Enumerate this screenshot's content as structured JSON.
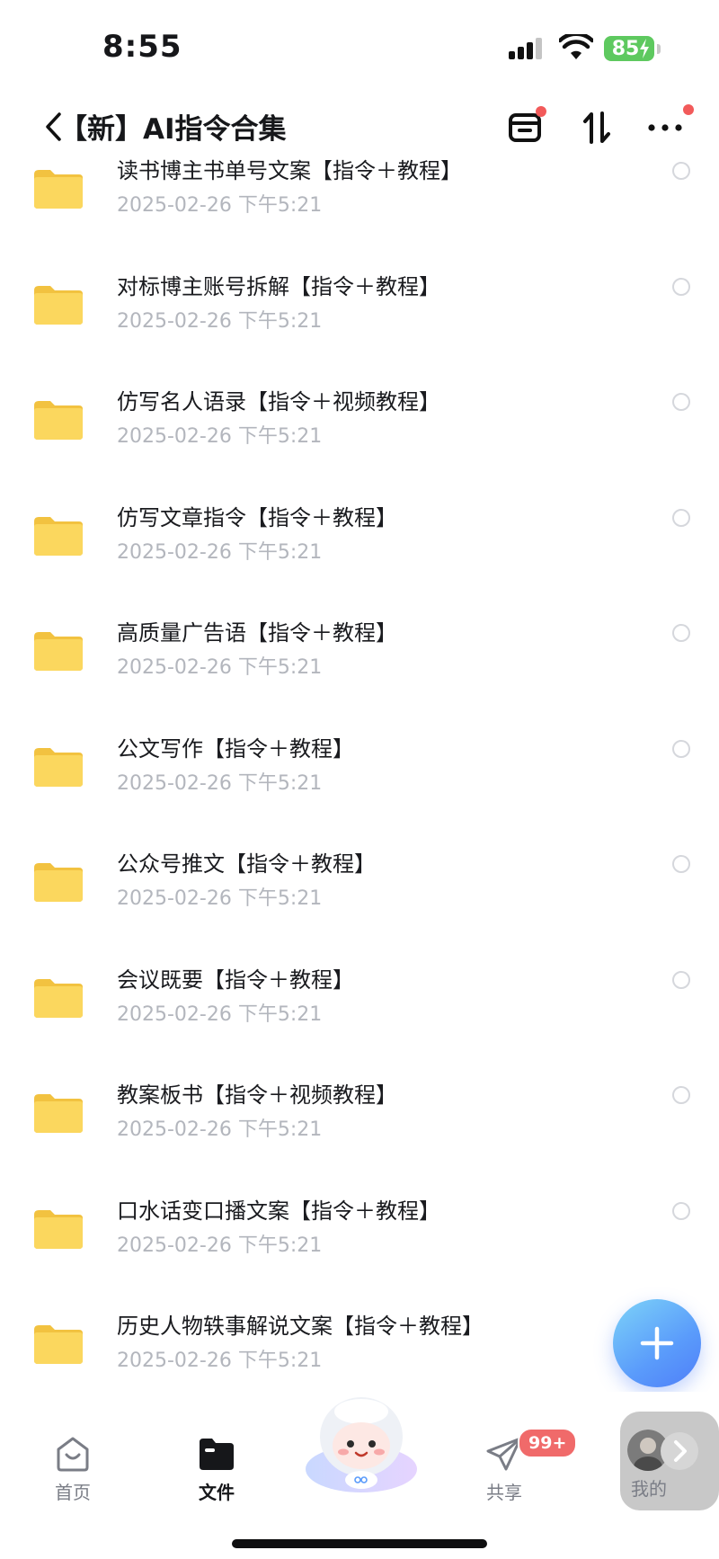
{
  "status": {
    "time": "8:55",
    "battery": "85"
  },
  "nav": {
    "back_title": "【新】AI指令合集"
  },
  "files": [
    {
      "title": "读书博主书单号文案【指令＋教程】",
      "date": "2025-02-26 下午5:21"
    },
    {
      "title": "对标博主账号拆解【指令＋教程】",
      "date": "2025-02-26 下午5:21"
    },
    {
      "title": "仿写名人语录【指令＋视频教程】",
      "date": "2025-02-26 下午5:21"
    },
    {
      "title": "仿写文章指令【指令＋教程】",
      "date": "2025-02-26 下午5:21"
    },
    {
      "title": "高质量广告语【指令＋教程】",
      "date": "2025-02-26 下午5:21"
    },
    {
      "title": "公文写作【指令＋教程】",
      "date": "2025-02-26 下午5:21"
    },
    {
      "title": "公众号推文【指令＋教程】",
      "date": "2025-02-26 下午5:21"
    },
    {
      "title": "会议既要【指令＋教程】",
      "date": "2025-02-26 下午5:21"
    },
    {
      "title": "教案板书【指令＋视频教程】",
      "date": "2025-02-26 下午5:21"
    },
    {
      "title": "口水话变口播文案【指令＋教程】",
      "date": "2025-02-26 下午5:21"
    },
    {
      "title": "历史人物轶事解说文案【指令＋教程】",
      "date": "2025-02-26 下午5:21"
    }
  ],
  "tabs": {
    "home": "首页",
    "files": "文件",
    "share": "共享",
    "mine": "我的"
  },
  "share_badge": "99+",
  "colors": {
    "accent": "#5a9bfb",
    "badge": "#f06a6a",
    "folder": "#f9cf4f"
  }
}
